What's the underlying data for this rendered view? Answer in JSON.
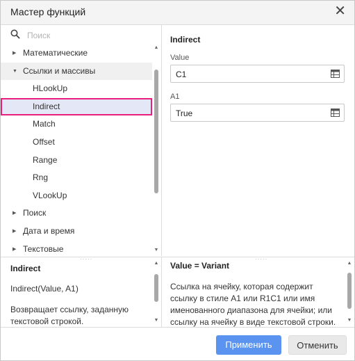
{
  "dialog": {
    "title": "Мастер функций",
    "close_glyph": "✕"
  },
  "search": {
    "placeholder": "Поиск"
  },
  "tree": {
    "categories_top": [
      {
        "label": "Математические",
        "arrow": "▶"
      },
      {
        "label": "Ссылки и массивы",
        "arrow": "▼"
      }
    ],
    "functions": [
      "HLookUp",
      "Indirect",
      "Match",
      "Offset",
      "Range",
      "Rng",
      "VLookUp"
    ],
    "selected_function": "Indirect",
    "categories_bottom": [
      {
        "label": "Поиск",
        "arrow": "▶"
      },
      {
        "label": "Дата и время",
        "arrow": "▶"
      },
      {
        "label": "Текстовые",
        "arrow": "▶"
      }
    ]
  },
  "scroll": {
    "up": "▲",
    "down": "▼"
  },
  "function_panel": {
    "name": "Indirect",
    "args": [
      {
        "label": "Value",
        "value": "C1"
      },
      {
        "label": "A1",
        "value": "True"
      }
    ]
  },
  "description": {
    "name": "Indirect",
    "signature": "Indirect(Value, A1)",
    "text": "Возвращает ссылку, заданную текстовой строкой.",
    "param_title": "Value = Variant",
    "param_text": "Ссылка на ячейку, которая содержит ссылку в стиле A1 или R1C1 или имя именованного диапазона для ячейки; или ссылку на ячейку в виде текстовой строки."
  },
  "buttons": {
    "apply": "Применить",
    "cancel": "Отменить"
  },
  "colors": {
    "accent": "#5b93f0",
    "selection_border": "#e91e7d",
    "selection_bg": "#e4e7f5"
  }
}
